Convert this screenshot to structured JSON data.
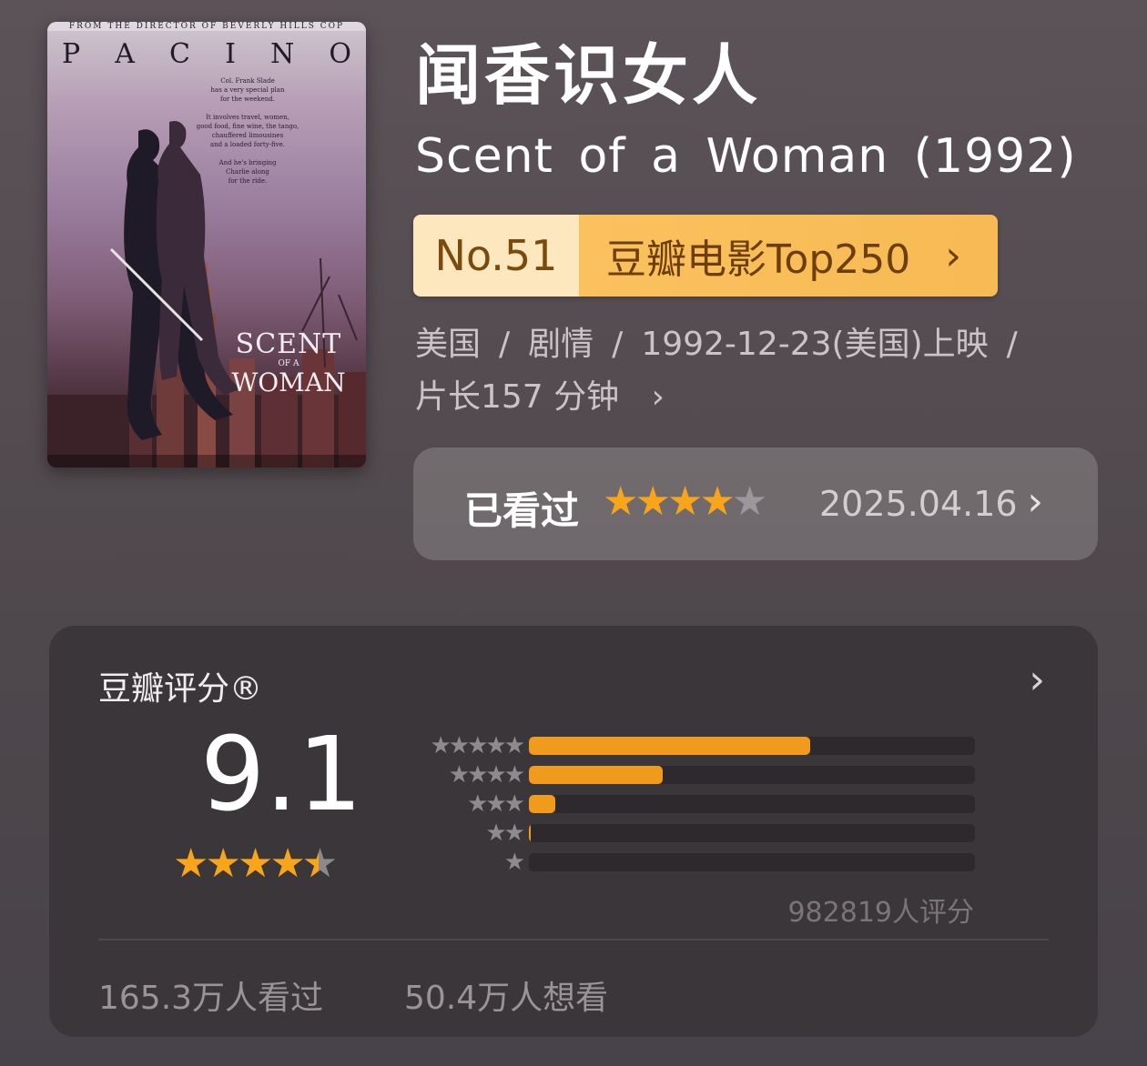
{
  "poster": {
    "top_tagline": "FROM THE DIRECTOR OF BEVERLY HILLS COP",
    "actor": "PACINO",
    "blurb": "Col. Frank Slade\nhas a very special plan\nfor the weekend.\n\nIt involves travel, women,\ngood food, fine wine, the tango,\nchauffered limousines\nand a loaded forty-five.\n\nAnd he's bringing\nCharlie along\nfor the ride.",
    "title_line1": "SCENT",
    "title_line2": "OF A",
    "title_line3": "WOMAN"
  },
  "movie": {
    "title_cn": "闻香识女人",
    "title_en": "Scent of a Woman (1992)"
  },
  "rank": {
    "number": "No.51",
    "list_name": "豆瓣电影Top250",
    "chevron": "›"
  },
  "meta": {
    "country": "美国",
    "genre": "剧情",
    "release": "1992-12-23(美国)上映",
    "separator": "/",
    "runtime": "片长157 分钟",
    "chevron": "›"
  },
  "my_rating": {
    "label": "已看过",
    "stars": 4,
    "max_stars": 5,
    "date": "2025.04.16",
    "chevron": "›"
  },
  "douban_rating": {
    "header": "豆瓣评分®",
    "chevron": "›",
    "score": "9.1",
    "star_value": 4.5,
    "distribution": [
      {
        "stars": 5,
        "fraction": 0.63
      },
      {
        "stars": 4,
        "fraction": 0.3
      },
      {
        "stars": 3,
        "fraction": 0.06
      },
      {
        "stars": 2,
        "fraction": 0.005
      },
      {
        "stars": 1,
        "fraction": 0.0
      }
    ],
    "count": "982819人评分",
    "watched": "165.3万人看过",
    "want": "50.4万人想看"
  },
  "colors": {
    "star_active": "#f8a51b",
    "bar_fill": "#f09a1e",
    "rank_number_bg": "#fde7be",
    "rank_list_bg": "#f7ba54"
  }
}
